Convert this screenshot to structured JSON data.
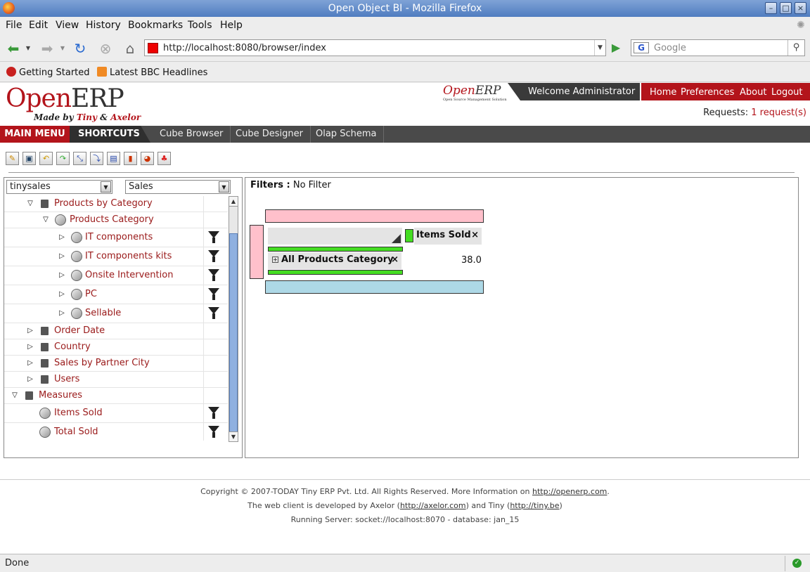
{
  "window": {
    "title": "Open Object BI - Mozilla Firefox"
  },
  "menubar": [
    "File",
    "Edit",
    "View",
    "History",
    "Bookmarks",
    "Tools",
    "Help"
  ],
  "navigation": {
    "url": "http://localhost:8080/browser/index",
    "search_placeholder": "Google"
  },
  "bookmarks": [
    "Getting Started",
    "Latest BBC Headlines"
  ],
  "header": {
    "logo_open": "Open",
    "logo_erp": "ERP",
    "logo_tagline_a": "Made by ",
    "logo_tagline_b": "Tiny",
    "logo_tagline_c": " & ",
    "logo_tagline_d": "Axelor",
    "minilogo_open": "Open",
    "minilogo_erp": "ERP",
    "minilogo_sub": "Open Source Management Solution",
    "welcome": "Welcome Administrator",
    "links": [
      "Home",
      "Preferences",
      "About",
      "Logout"
    ],
    "requests_label": "Requests:",
    "requests_link": "1 request(s)"
  },
  "mainnav": {
    "main_menu": "MAIN MENU",
    "shortcuts": "SHORTCUTS",
    "items": [
      "Cube Browser",
      "Cube Designer",
      "Olap Schema"
    ]
  },
  "leftpanel": {
    "schema_select": "tinysales",
    "cube_select": "Sales",
    "tree": [
      {
        "label": "Products by Category"
      },
      {
        "label": "Products Category"
      },
      {
        "label": "IT components"
      },
      {
        "label": "IT components kits"
      },
      {
        "label": "Onsite Intervention"
      },
      {
        "label": "PC"
      },
      {
        "label": "Sellable"
      },
      {
        "label": "Order Date"
      },
      {
        "label": "Country"
      },
      {
        "label": "Sales by Partner City"
      },
      {
        "label": "Users"
      },
      {
        "label": "Measures"
      },
      {
        "label": "Items Sold"
      },
      {
        "label": "Total Sold"
      }
    ]
  },
  "rightpanel": {
    "filters_label": "Filters :",
    "filters_value": "No Filter",
    "measure_chip": "Items Sold",
    "row_chip": "All Products Category",
    "chip_close": "×",
    "cell_value": "38.0"
  },
  "footer": {
    "line1_text": "Copyright © 2007-TODAY Tiny ERP Pvt. Ltd. All Rights Reserved. More Information on ",
    "line1_link": "http://openerp.com",
    "line1_end": ".",
    "line2_a": "The web client is developed by Axelor (",
    "line2_link1": "http://axelor.com",
    "line2_b": ") and Tiny (",
    "line2_link2": "http://tiny.be",
    "line2_c": ")",
    "line3": "Running Server: socket://localhost:8070 - database: jan_15"
  },
  "status": {
    "text": "Done"
  },
  "colors": {
    "brand_red": "#b3141b",
    "dark_nav": "#4a4a4a",
    "pink_axis": "#ffc0cb",
    "blue_axis": "#add8e6",
    "green_axis": "#44dd22"
  }
}
